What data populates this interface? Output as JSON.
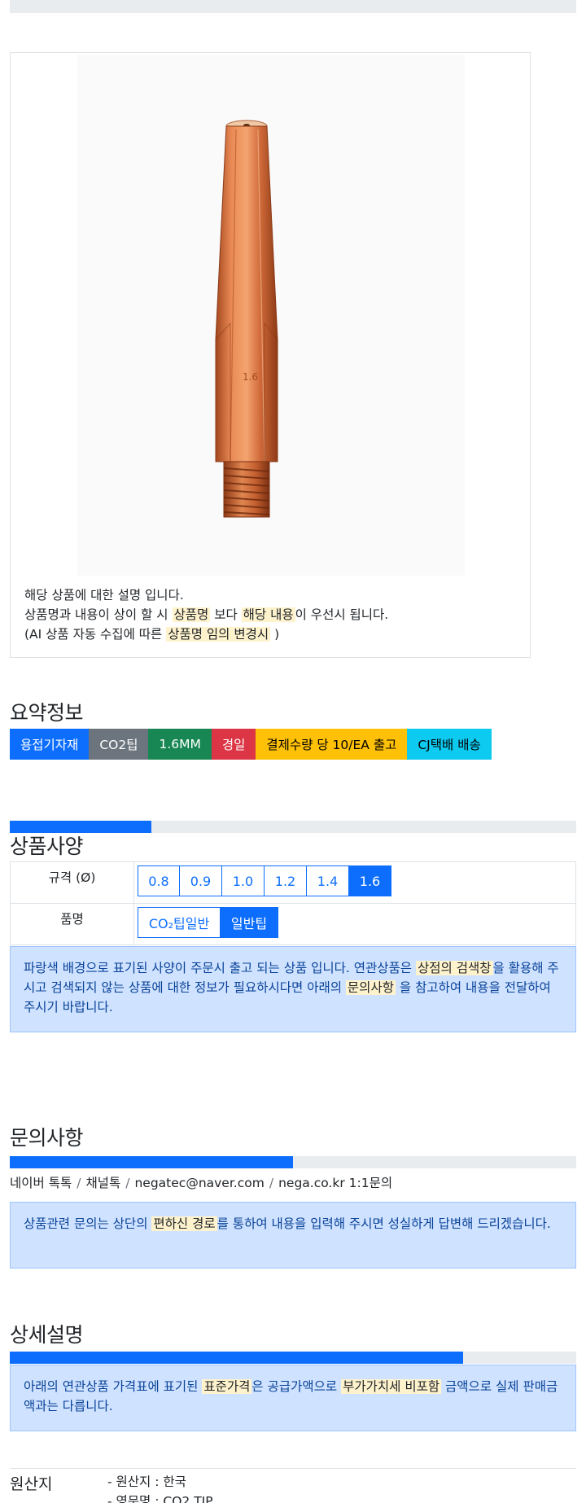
{
  "product": {
    "image_alt": "CO2 contact tip",
    "note_line1": "해당 상품에 대한 설명 입니다.",
    "note_line2_pre": "상품명과 내용이 상이 할 시 ",
    "note_line2_hl1": "상품명",
    "note_line2_mid": " 보다 ",
    "note_line2_hl2": "해당 내용",
    "note_line2_post": "이 우선시 됩니다.",
    "note_line3_pre": "(AI 상품 자동 수집에 따른 ",
    "note_line3_hl": "상품명 임의 변경시",
    "note_line3_post": " )"
  },
  "summary": {
    "title": "요약정보",
    "badges": [
      {
        "label": "용접기자재",
        "color": "#0d6efd",
        "text_color": "#ffffff"
      },
      {
        "label": "CO2팁",
        "color": "#6c757d",
        "text_color": "#ffffff"
      },
      {
        "label": "1.6MM",
        "color": "#198754",
        "text_color": "#ffffff"
      },
      {
        "label": "경일",
        "color": "#dc3545",
        "text_color": "#ffffff"
      },
      {
        "label": "결제수량 당 10/EA 출고",
        "color": "#ffc107",
        "text_color": "#000000"
      },
      {
        "label": "CJ택배 배송",
        "color": "#0dcaf0",
        "text_color": "#000000"
      }
    ]
  },
  "spec": {
    "title": "상품사양",
    "progress": 0.25,
    "size_label": "규격 (Ø)",
    "size_options": [
      "0.8",
      "0.9",
      "1.0",
      "1.2",
      "1.4",
      "1.6"
    ],
    "size_selected": "1.6",
    "name_label": "품명",
    "name_options": [
      "CO₂팁일반",
      "일반팁"
    ],
    "name_selected": "일반팁",
    "alert_pre": "파랑색 배경으로 표기된 사양이 주문시 출고 되는 상품 입니다. 연관상품은 ",
    "alert_hl1": "상점의 검색창",
    "alert_mid": "을 활용해 주시고 검색되지 않는 상품에 대한 정보가 필요하시다면 아래의 ",
    "alert_hl2": "문의사항",
    "alert_post": " 을 참고하여 내용을 전달하여 주시기 바랍니다."
  },
  "inquiry": {
    "title": "문의사항",
    "progress": 0.5,
    "links": [
      "네이버 톡톡",
      "채널톡",
      "negatec@naver.com",
      "nega.co.kr 1:1문의"
    ],
    "separator": "/",
    "alert_pre": "상품관련 문의는 상단의 ",
    "alert_hl": "편하신 경로",
    "alert_post": "를 통하여 내용을 입력해 주시면 성실하게 답변해 드리겠습니다."
  },
  "detail": {
    "title": "상세설명",
    "progress": 0.8,
    "alert_pre": "아래의 연관상품 가격표에 표기된 ",
    "alert_hl1": "표준가격",
    "alert_mid": "은 공급가액으로 ",
    "alert_hl2": "부가가치세 비포함",
    "alert_post": " 금액으로 실제 판매금액과는 다릅니다."
  },
  "origin": {
    "label": "원산지",
    "items": [
      "- 원산지 : 한국",
      "- 영문명 : CO2 TIP"
    ]
  }
}
